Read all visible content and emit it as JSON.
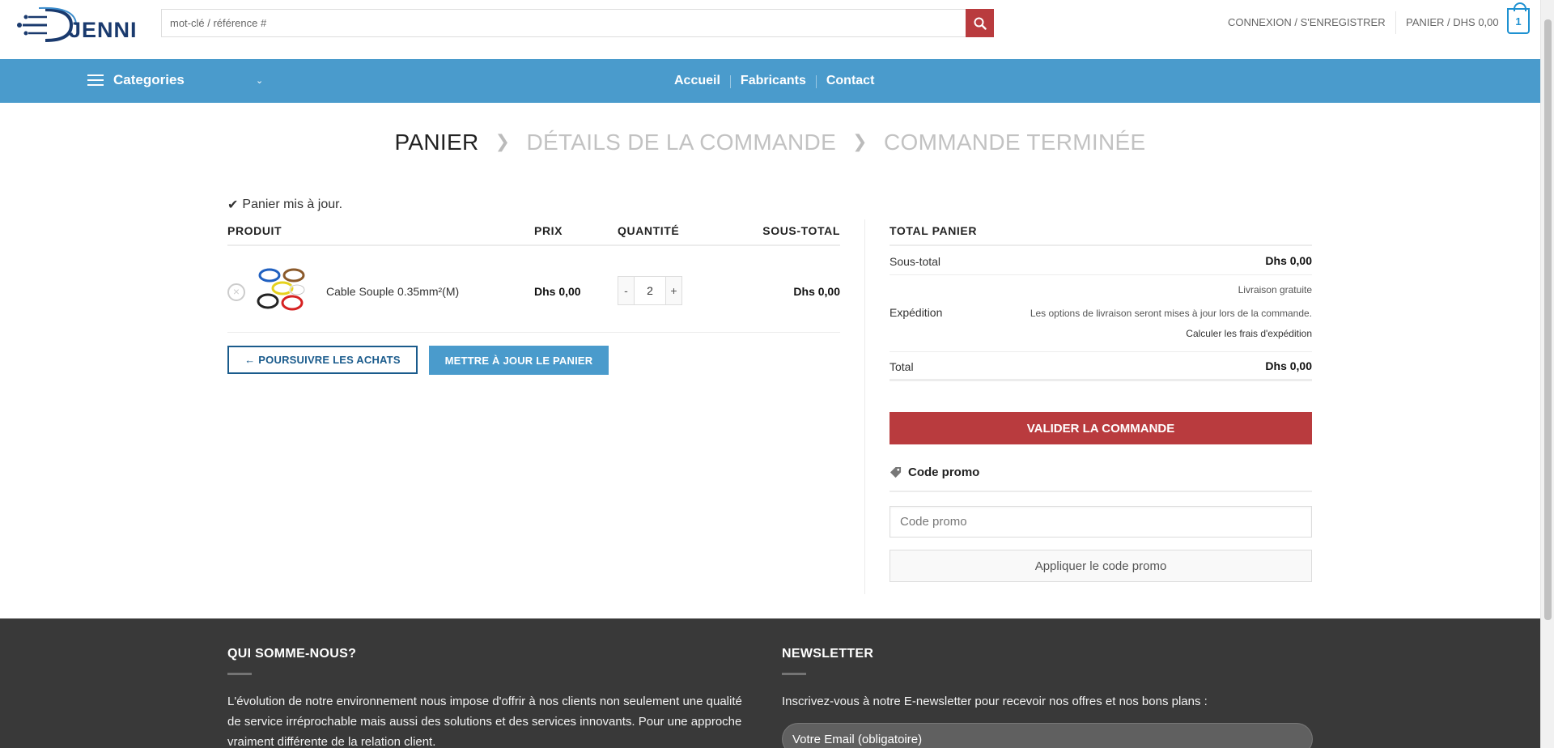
{
  "header": {
    "logo_text": "JENNI",
    "search_placeholder": "mot-clé / référence #",
    "login_label": "CONNEXION / S'ENREGISTRER",
    "cart_label": "PANIER / DHS 0,00",
    "cart_count": "1"
  },
  "nav": {
    "categories_label": "Categories",
    "links": [
      "Accueil",
      "Fabricants",
      "Contact"
    ]
  },
  "breadcrumb": {
    "step1": "PANIER",
    "step2": "DÉTAILS DE LA COMMANDE",
    "step3": "COMMANDE TERMINÉE"
  },
  "notice": "Panier mis à jour.",
  "cart_table": {
    "headers": {
      "product": "PRODUIT",
      "price": "PRIX",
      "quantity": "QUANTITÉ",
      "subtotal": "SOUS-TOTAL"
    },
    "items": [
      {
        "name": "Cable Souple 0.35mm²(M)",
        "price": "Dhs 0,00",
        "quantity": "2",
        "subtotal": "Dhs 0,00",
        "remove": "×",
        "minus": "-",
        "plus": "+"
      }
    ],
    "continue_label": "← POURSUIVRE LES ACHATS",
    "update_label": "METTRE À JOUR LE PANIER"
  },
  "totals": {
    "title": "TOTAL PANIER",
    "subtotal_label": "Sous-total",
    "subtotal_value": "Dhs 0,00",
    "shipping_label": "Expédition",
    "shipping_free": "Livraison gratuite",
    "shipping_note": "Les options de livraison seront mises à jour lors de la commande.",
    "shipping_calc": "Calculer les frais d'expédition",
    "total_label": "Total",
    "total_value": "Dhs 0,00",
    "checkout_label": "VALIDER LA COMMANDE"
  },
  "promo": {
    "title": "Code promo",
    "placeholder": "Code promo",
    "apply_label": "Appliquer le code promo"
  },
  "footer": {
    "about_title": "QUI SOMME-NOUS?",
    "about_text": "L'évolution de notre environnement nous impose d'offrir à nos clients non seulement une qualité de service irréprochable mais aussi des solutions et des services innovants. Pour une approche vraiment différente de la relation client.",
    "newsletter_title": "NEWSLETTER",
    "newsletter_text": "Inscrivez-vous à notre E-newsletter pour recevoir nos offres et nos bons plans :",
    "email_placeholder": "Votre Email (obligatoire)"
  },
  "colors": {
    "brand_blue": "#4a9bcc",
    "brand_red": "#b93b3e",
    "footer_bg": "#393939"
  }
}
